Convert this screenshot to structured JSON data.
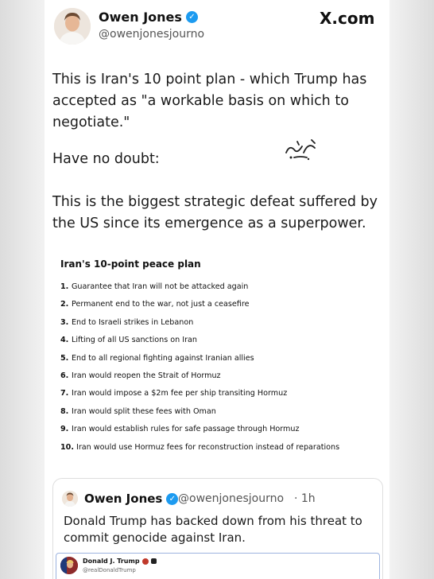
{
  "header": {
    "name": "Owen Jones",
    "handle": "@owenjonesjourno",
    "brand": "X.com"
  },
  "tweet": {
    "paragraph1": "This is Iran's 10 point plan - which Trump has accepted as \"a workable basis on which to negotiate.\"",
    "paragraph2": "Have no doubt:",
    "paragraph3": "This is the biggest strategic defeat suffered by the US since its emergence as a superpower."
  },
  "plan": {
    "title": "Iran's 10-point peace plan",
    "items": [
      {
        "num": "1.",
        "text": "Guarantee that Iran will not be attacked again"
      },
      {
        "num": "2.",
        "text": "Permanent end to the war, not just a ceasefire"
      },
      {
        "num": "3.",
        "text": "End to Israeli strikes in Lebanon"
      },
      {
        "num": "4.",
        "text": "Lifting of all US sanctions on Iran"
      },
      {
        "num": "5.",
        "text": "End to all regional fighting against Iranian allies"
      },
      {
        "num": "6.",
        "text": "Iran would reopen the Strait of Hormuz"
      },
      {
        "num": "7.",
        "text": "Iran would impose a $2m fee per ship transiting Hormuz"
      },
      {
        "num": "8.",
        "text": "Iran would split these fees with Oman"
      },
      {
        "num": "9.",
        "text": "Iran would establish rules for safe passage through Hormuz"
      },
      {
        "num": "10.",
        "text": "Iran would use Hormuz fees for reconstruction instead of reparations"
      }
    ]
  },
  "quote": {
    "name": "Owen Jones",
    "handle": "@owenjonesjourno",
    "time": "· 1h",
    "body": "Donald Trump has backed down from his threat to commit genocide against Iran.",
    "embed": {
      "name": "Donald J. Trump",
      "handle": "@realDonaldTrump"
    }
  },
  "colors": {
    "verified": "#1d9bf0",
    "card_bg": "#ffffff",
    "page_bg": "#e9e9e9"
  },
  "icons": [
    "verified-badge-icon",
    "x-logo-icon",
    "watermark-logo"
  ]
}
